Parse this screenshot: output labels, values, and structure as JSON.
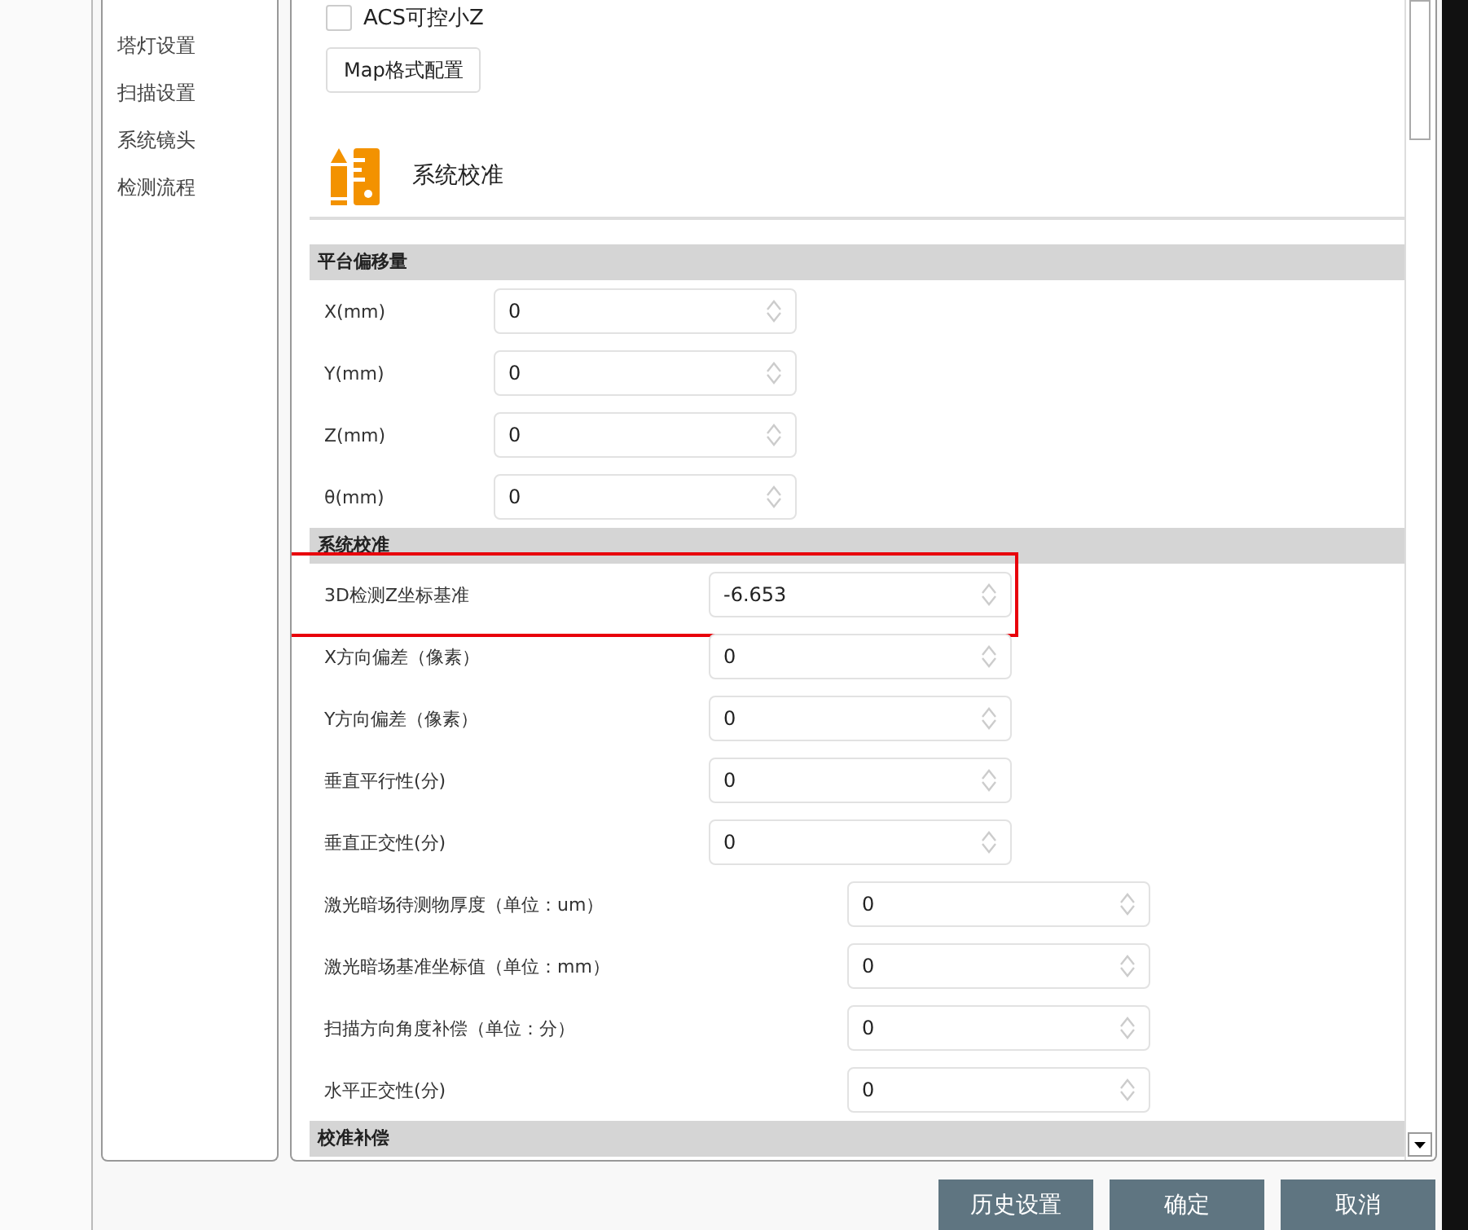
{
  "sidebar": {
    "items": [
      {
        "label": "塔灯设置",
        "selected": false
      },
      {
        "label": "扫描设置",
        "selected": false
      },
      {
        "label": "系统镜头",
        "selected": false
      },
      {
        "label": "检测流程",
        "selected": false
      }
    ]
  },
  "options": {
    "checkbox": {
      "label": "ACS可控小Z",
      "checked": false
    },
    "button": "Map格式配置"
  },
  "section_title": "系统校准",
  "groups": [
    {
      "header": "平台偏移量",
      "rows": [
        {
          "label": "X(mm)",
          "value": "0",
          "kind": "narrow",
          "highlighted": false
        },
        {
          "label": "Y(mm)",
          "value": "0",
          "kind": "narrow",
          "highlighted": false
        },
        {
          "label": "Z(mm)",
          "value": "0",
          "kind": "narrow",
          "highlighted": false
        },
        {
          "label": "θ(mm)",
          "value": "0",
          "kind": "narrow",
          "highlighted": false
        }
      ]
    },
    {
      "header": "系统校准",
      "rows": [
        {
          "label": "3D检测Z坐标基准",
          "value": "-6.653",
          "kind": "medium",
          "highlighted": true
        },
        {
          "label": "X方向偏差（像素）",
          "value": "0",
          "kind": "medium",
          "highlighted": false
        },
        {
          "label": "Y方向偏差（像素）",
          "value": "0",
          "kind": "medium",
          "highlighted": false
        },
        {
          "label": "垂直平行性(分)",
          "value": "0",
          "kind": "medium",
          "highlighted": false
        },
        {
          "label": "垂直正交性(分)",
          "value": "0",
          "kind": "medium",
          "highlighted": false
        },
        {
          "label": "激光暗场待测物厚度（单位：um）",
          "value": "0",
          "kind": "wide",
          "highlighted": false
        },
        {
          "label": "激光暗场基准坐标值（单位：mm）",
          "value": "0",
          "kind": "wide",
          "highlighted": false
        },
        {
          "label": "扫描方向角度补偿（单位：分）",
          "value": "0",
          "kind": "wide",
          "highlighted": false
        },
        {
          "label": "水平正交性(分)",
          "value": "0",
          "kind": "wide",
          "highlighted": false
        }
      ]
    },
    {
      "header": "校准补偿"
    }
  ],
  "buttons": [
    "历史设置",
    "确定",
    "取消"
  ]
}
